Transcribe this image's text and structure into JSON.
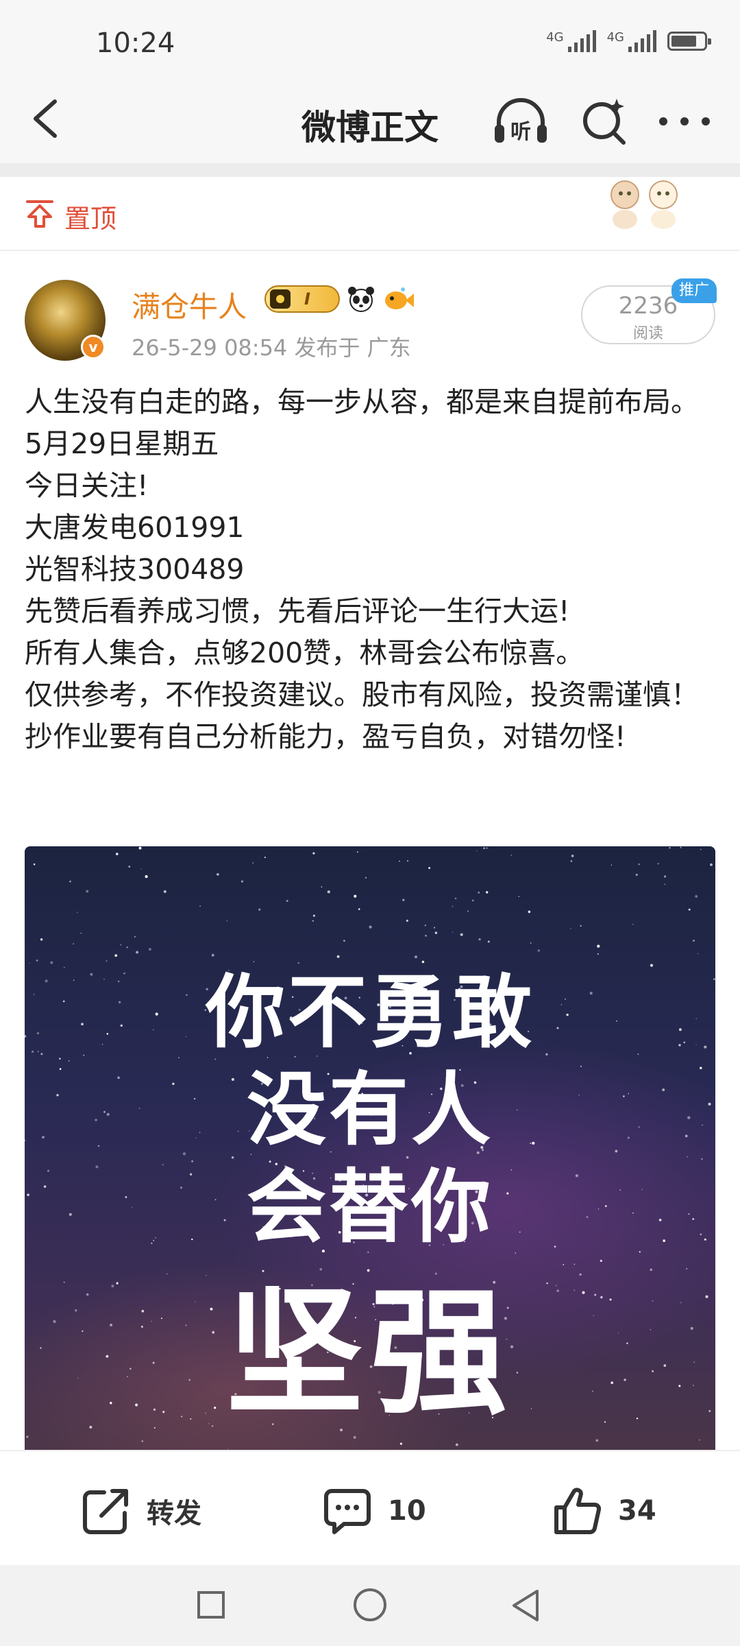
{
  "status_bar": {
    "time": "10:24",
    "signal1_label": "4G",
    "signal2_label": "4G"
  },
  "nav": {
    "title": "微博正文",
    "listen_label": "听"
  },
  "pinned": {
    "label": "置顶"
  },
  "post": {
    "username": "满仓牛人",
    "badge_roman": "I",
    "verify_mark": "v",
    "meta": "26-5-29 08:54  发布于 广东",
    "read_count": "2236",
    "read_label": "阅读",
    "promo_tag": "推广",
    "body": [
      "人生没有白走的路，每一步从容，都是来自提前布局。",
      "5月29日星期五",
      "今日关注!",
      "大唐发电601991",
      "光智科技300489",
      "先赞后看养成习惯，先看后评论一生行大运!",
      "所有人集合，点够200赞，林哥会公布惊喜。",
      "仅供参考，不作投资建议。股市有风险，投资需谨慎！抄作业要有自己分析能力，盈亏自负，对错勿怪!"
    ],
    "image_text": [
      "你不勇敢",
      "没有人",
      "会替你",
      "坚强"
    ]
  },
  "actions": {
    "repost_label": "转发",
    "comment_count": "10",
    "like_count": "34"
  },
  "colors": {
    "username": "#e6821e",
    "pin_accent": "#e04f3a",
    "promo_blue": "#3aa0e8",
    "meta_gray": "#9a9a9a"
  }
}
